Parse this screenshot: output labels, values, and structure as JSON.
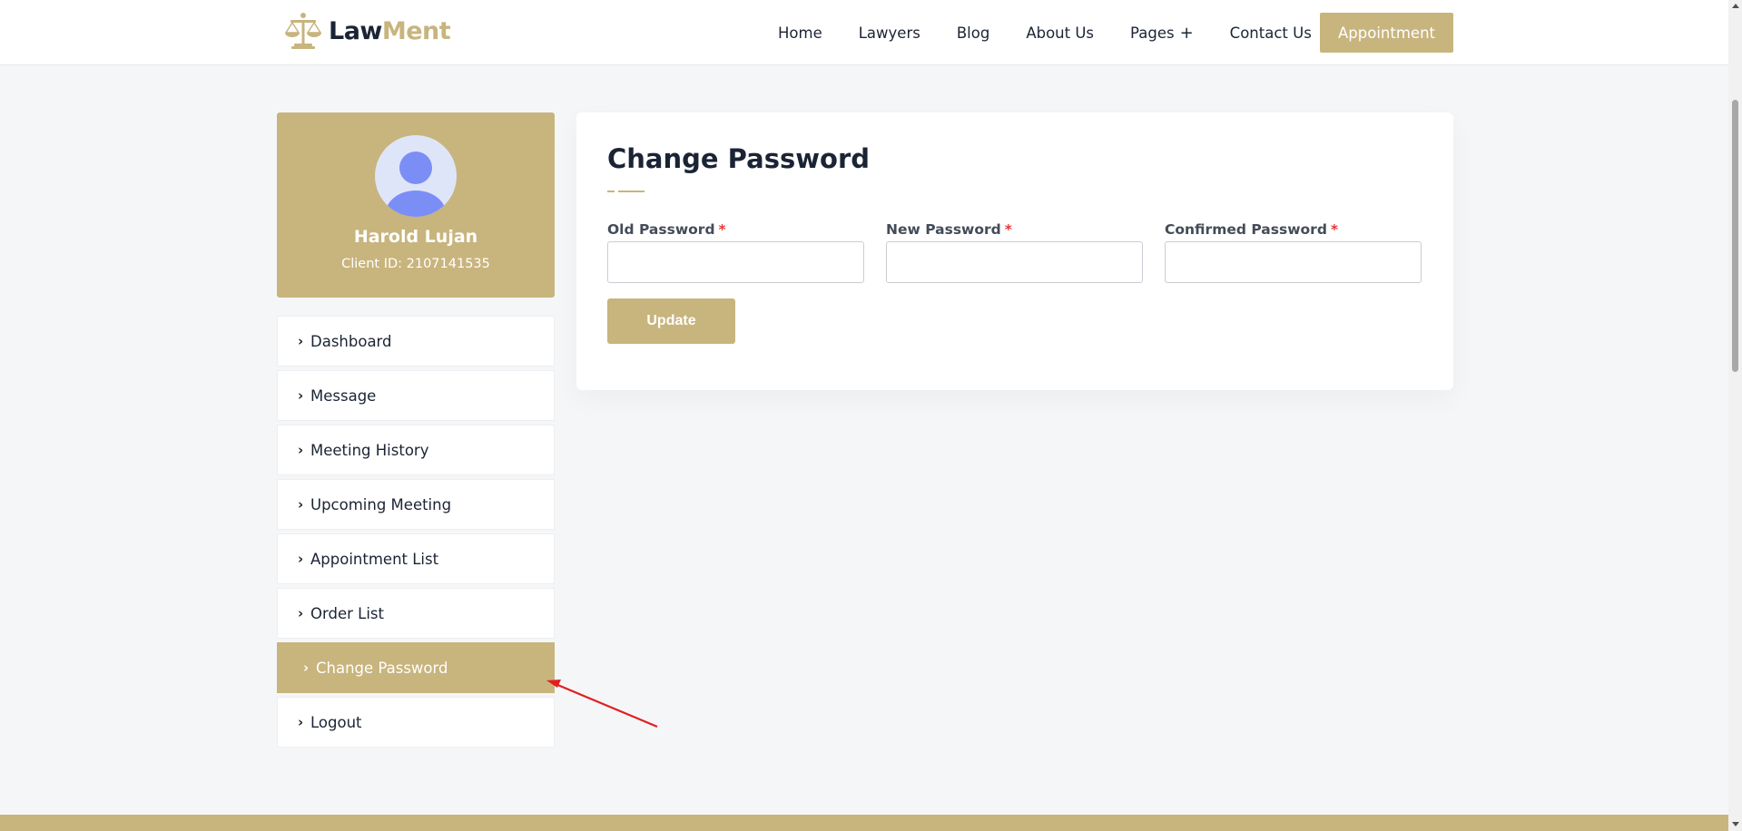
{
  "brand": {
    "part1": "Law",
    "part2": "Ment",
    "accent_color": "#c8b47d",
    "dark_color": "#1b2434"
  },
  "nav": {
    "items": [
      "Home",
      "Lawyers",
      "Blog",
      "About Us",
      "Pages",
      "Contact Us"
    ],
    "pages_plus": "+",
    "appointment": "Appointment"
  },
  "profile": {
    "name": "Harold Lujan",
    "client_id": "Client ID: 2107141535"
  },
  "menu": {
    "items": [
      {
        "label": "Dashboard",
        "active": false
      },
      {
        "label": "Message",
        "active": false
      },
      {
        "label": "Meeting History",
        "active": false
      },
      {
        "label": "Upcoming Meeting",
        "active": false
      },
      {
        "label": "Appointment List",
        "active": false
      },
      {
        "label": "Order List",
        "active": false
      },
      {
        "label": "Change Password",
        "active": true
      },
      {
        "label": "Logout",
        "active": false
      }
    ],
    "chevron_icon": "chevron-right-icon"
  },
  "form": {
    "title": "Change Password",
    "fields": [
      {
        "label": "Old Password",
        "required_mark": "*",
        "value": ""
      },
      {
        "label": "New Password",
        "required_mark": "*",
        "value": ""
      },
      {
        "label": "Confirmed Password",
        "required_mark": "*",
        "value": ""
      }
    ],
    "submit": "Update"
  },
  "annotation": {
    "arrow_color": "#e02020"
  }
}
